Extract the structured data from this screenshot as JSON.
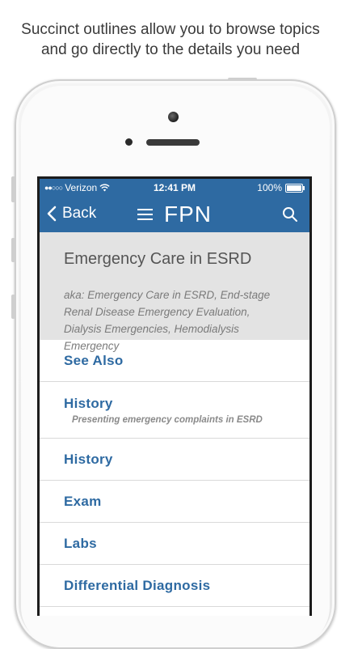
{
  "caption": {
    "line1": "Succinct outlines allow you to browse topics",
    "line2": "and go directly to the details you need"
  },
  "status_bar": {
    "carrier": "Verizon",
    "signal_dots": "●●○○○",
    "time": "12:41 PM",
    "battery": "100%"
  },
  "nav": {
    "back_label": "Back",
    "brand": "FPN"
  },
  "topic": {
    "title": "Emergency Care in ESRD",
    "aka": "aka: Emergency Care in ESRD, End-stage Renal Disease Emergency Evaluation, Dialysis Emergencies, Hemodialysis Emergency"
  },
  "sections": [
    {
      "label": "See Also",
      "sub": ""
    },
    {
      "label": "History",
      "sub": "Presenting emergency complaints in ESRD"
    },
    {
      "label": "History",
      "sub": ""
    },
    {
      "label": "Exam",
      "sub": ""
    },
    {
      "label": "Labs",
      "sub": ""
    },
    {
      "label": "Differential Diagnosis",
      "sub": ""
    }
  ],
  "colors": {
    "accent": "#2e6aa2",
    "header_bg": "#e3e3e3"
  }
}
